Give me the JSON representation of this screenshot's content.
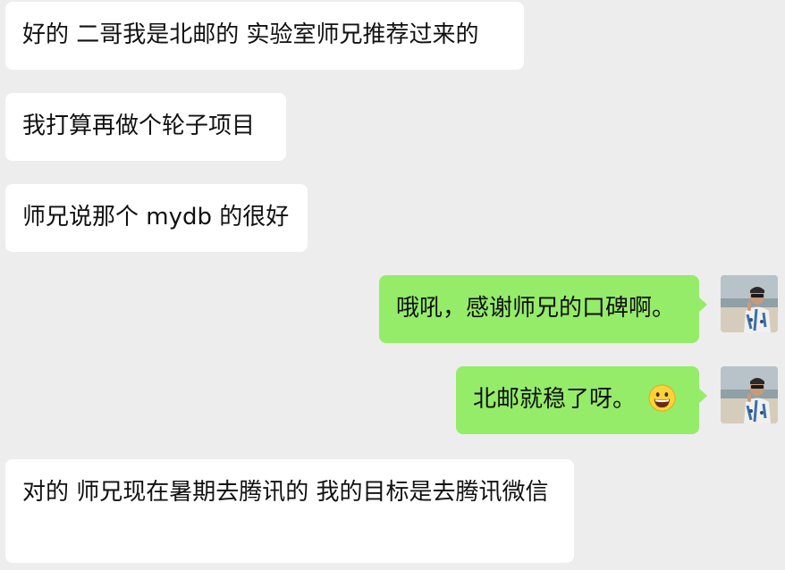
{
  "conversation": {
    "messages": [
      {
        "direction": "incoming",
        "text": "好的 二哥我是北邮的 实验室师兄推荐过来的"
      },
      {
        "direction": "incoming",
        "text": "我打算再做个轮子项目"
      },
      {
        "direction": "incoming",
        "text": "师兄说那个 mydb 的很好"
      },
      {
        "direction": "outgoing",
        "text": "哦吼，感谢师兄的口碑啊。",
        "avatar_icon": "user-avatar-photo"
      },
      {
        "direction": "outgoing",
        "text": "北邮就稳了呀。",
        "emoji_icon": "grinning-face-emoji",
        "avatar_icon": "user-avatar-photo"
      },
      {
        "direction": "incoming",
        "text": "对的 师兄现在暑期去腾讯的 我的目标是去腾讯微信"
      }
    ]
  },
  "colors": {
    "background": "#ededed",
    "incoming_bubble": "#ffffff",
    "outgoing_bubble": "#95ec69",
    "text": "#111111"
  }
}
